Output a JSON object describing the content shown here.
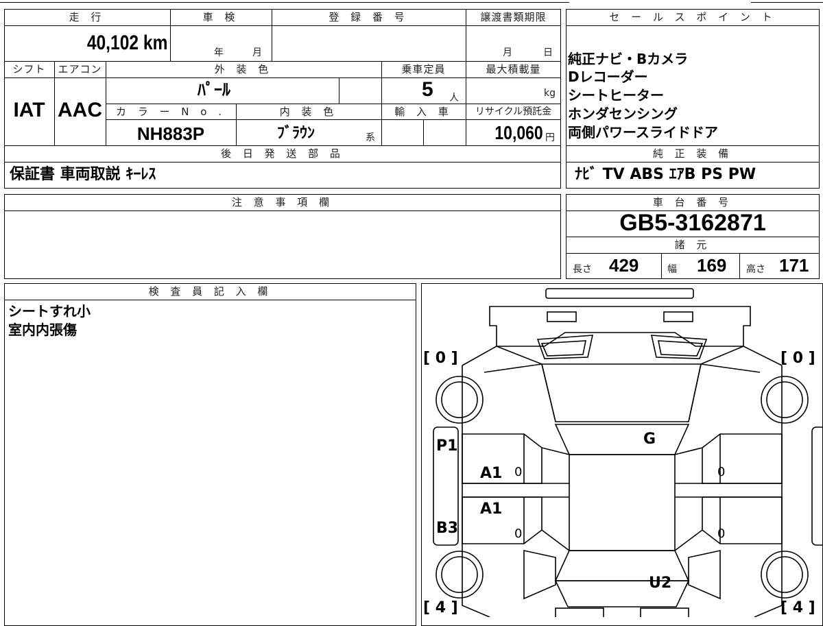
{
  "headers": {
    "mileage": "走 行",
    "inspection": "車 検",
    "registration": "登 録 番 号",
    "transfer_deadline": "譲渡書類期限",
    "sales_points": "セ ー ル ス ポ イ ン ト",
    "shift": "シフト",
    "aircon": "エアコン",
    "exterior_color": "外 装 色",
    "capacity": "乗車定員",
    "max_load": "最大積載量",
    "color_no": "カ ラ ー N o .",
    "interior_color": "内 装 色",
    "import": "輸 入 車",
    "recycle_deposit": "リサイクル預託金",
    "later_parts": "後 日 発 送 部 品",
    "genuine_equipment": "純 正 装 備",
    "notes": "注 意 事 項 欄",
    "chassis_number": "車 台 番 号",
    "specs": "諸 元",
    "inspector": "検 査 員 記 入 欄"
  },
  "values": {
    "mileage": "40,102 km",
    "inspection_year_unit": "年",
    "inspection_month_unit": "月",
    "transfer_month_unit": "月",
    "transfer_day_unit": "日",
    "shift": "IAT",
    "aircon": "AAC",
    "exterior_color": "ﾊﾟｰﾙ",
    "capacity": "5",
    "capacity_unit": "人",
    "max_load_unit": "kg",
    "color_no": "NH883P",
    "interior_color": "ﾌﾞﾗｳﾝ",
    "interior_color_suffix": "系",
    "recycle_deposit": "10,060",
    "recycle_unit": "円",
    "later_parts": "保証書 車両取説 ｷｰﾚｽ",
    "genuine_equipment": "ﾅﾋﾞ TV ABS ｴｱB PS PW",
    "chassis_number": "GB5-3162871",
    "length_label": "長さ",
    "length": "429",
    "width_label": "幅",
    "width": "169",
    "height_label": "高さ",
    "height": "171"
  },
  "sales_points": [
    "純正ナビ・Bカメラ",
    "Dレコーダー",
    "シートヒーター",
    "ホンダセンシング",
    "両側パワースライドドア"
  ],
  "inspector_notes": [
    "シートすれ小",
    "室内内張傷"
  ],
  "diagram": {
    "tire_fl": "[ 0 ]",
    "tire_fr": "[ 0 ]",
    "tire_rl": "[ 4 ]",
    "tire_rr": "[ 4 ]",
    "marks": [
      "G",
      "P1",
      "A1",
      "A1",
      "B3",
      "U2"
    ],
    "zero_marks": [
      "0",
      "0",
      "0",
      "0"
    ]
  }
}
